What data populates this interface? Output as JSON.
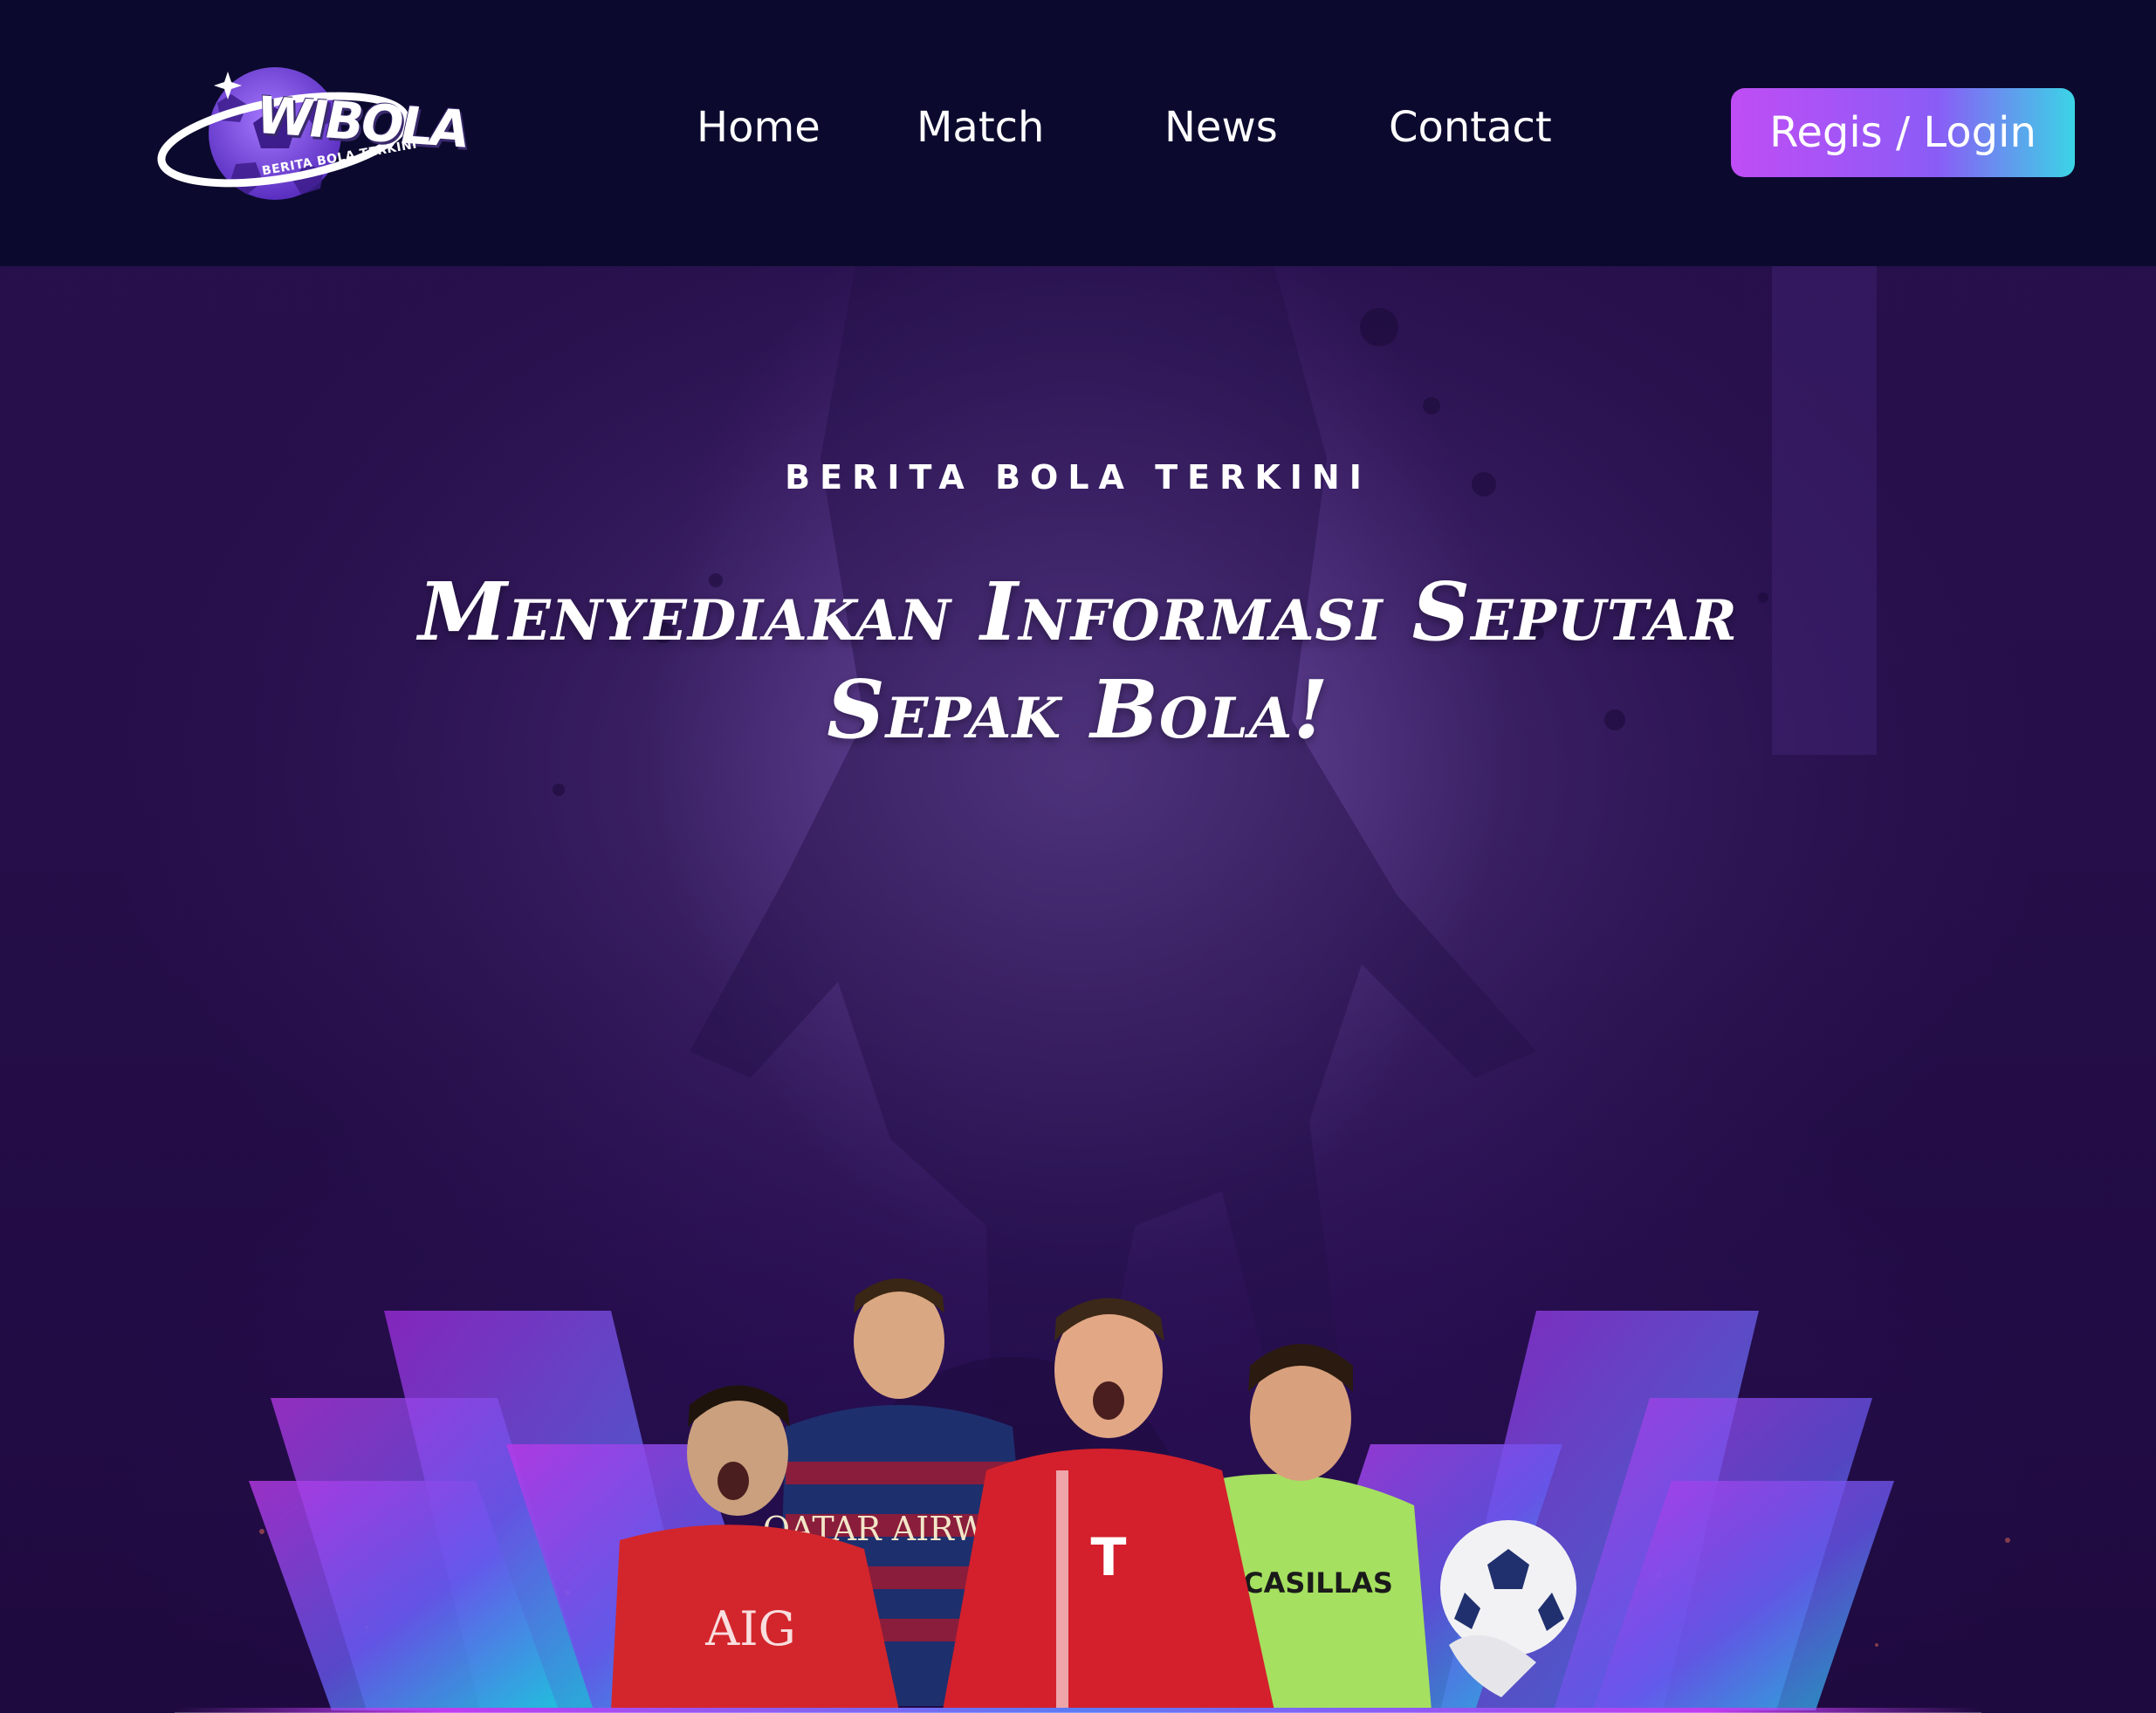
{
  "brand": {
    "name": "WIBOLA",
    "tagline": "BERITA BOLA TERKINI",
    "colors": {
      "primary": "#8a5cf6",
      "accent_pink": "#c04df5",
      "accent_cyan": "#3bd4e6",
      "header_bg": "#0b0a2e"
    }
  },
  "nav": {
    "items": [
      {
        "label": "Home"
      },
      {
        "label": "Match"
      },
      {
        "label": "News"
      },
      {
        "label": "Contact"
      }
    ],
    "cta_label": "Regis / Login"
  },
  "hero": {
    "subtitle": "BERITA BOLA TERKINI",
    "headline_line1": "Menyediakan Informasi Seputar",
    "headline_line2": "Sepak Bola!",
    "players": [
      {
        "kit": "red-club-kit",
        "shirt_text": "AIG"
      },
      {
        "kit": "blaugrana-kit",
        "shirt_text": "QATAR AIRWAYS"
      },
      {
        "kit": "red-white-kit"
      },
      {
        "kit": "green-goalkeeper-kit",
        "shirt_text": "CASILLAS"
      }
    ]
  }
}
